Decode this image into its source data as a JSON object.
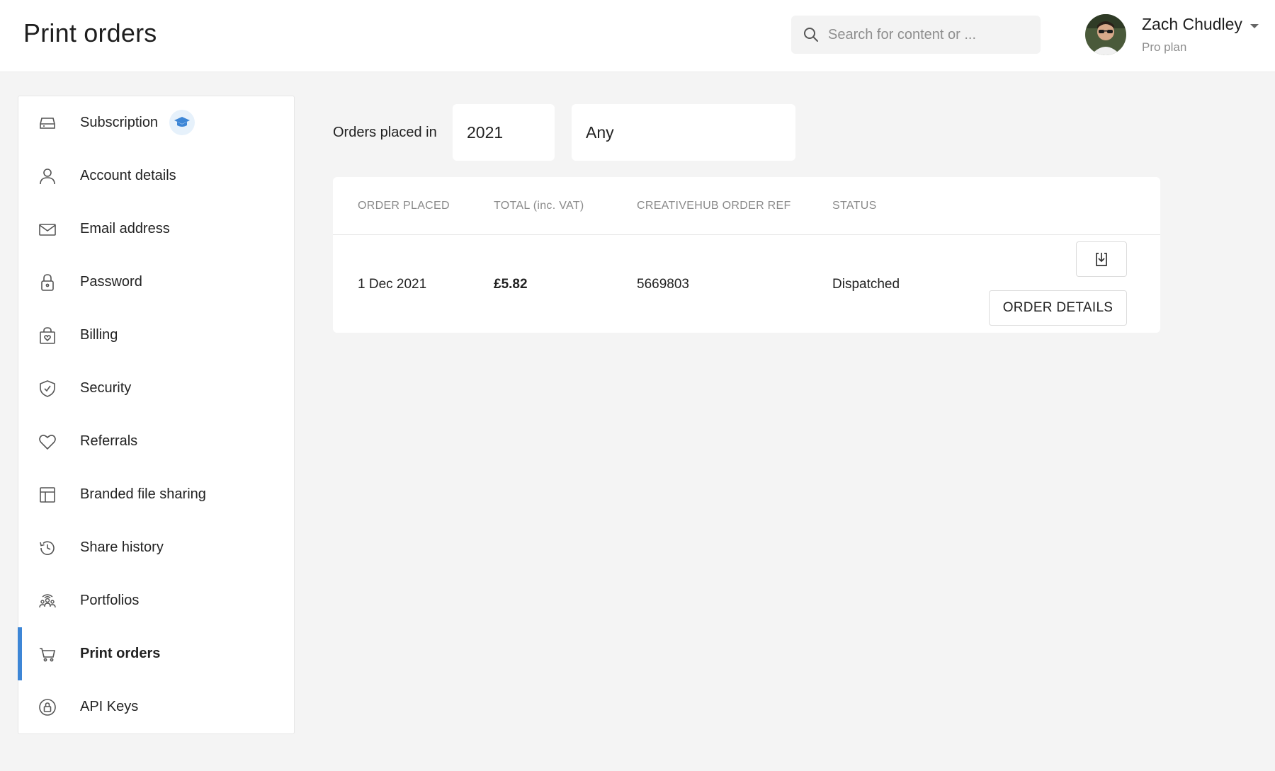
{
  "header": {
    "title": "Print orders",
    "search_placeholder": "Search for content or ...",
    "user": {
      "name": "Zach Chudley",
      "plan": "Pro plan"
    }
  },
  "sidebar": {
    "items": [
      {
        "label": "Subscription",
        "icon": "subscription-icon"
      },
      {
        "label": "Account details",
        "icon": "user-icon"
      },
      {
        "label": "Email address",
        "icon": "envelope-icon"
      },
      {
        "label": "Password",
        "icon": "lock-icon"
      },
      {
        "label": "Billing",
        "icon": "shopping-bag-icon"
      },
      {
        "label": "Security",
        "icon": "shield-icon"
      },
      {
        "label": "Referrals",
        "icon": "heart-icon"
      },
      {
        "label": "Branded file sharing",
        "icon": "layout-icon"
      },
      {
        "label": "Share history",
        "icon": "history-icon"
      },
      {
        "label": "Portfolios",
        "icon": "people-icon"
      },
      {
        "label": "Print orders",
        "icon": "cart-icon",
        "active": true
      },
      {
        "label": "API Keys",
        "icon": "key-lock-icon"
      }
    ]
  },
  "filters": {
    "label": "Orders placed in",
    "year": "2021",
    "status": "Any"
  },
  "orders": {
    "columns": [
      "ORDER PLACED",
      "TOTAL (inc. VAT)",
      "CREATIVEHUB ORDER REF",
      "STATUS"
    ],
    "rows": [
      {
        "date": "1 Dec 2021",
        "total": "£5.82",
        "ref": "5669803",
        "status": "Dispatched"
      }
    ],
    "details_label": "ORDER DETAILS"
  },
  "colors": {
    "accent": "#3d86d6",
    "background": "#f4f4f4",
    "muted_text": "#8a8a8a"
  }
}
